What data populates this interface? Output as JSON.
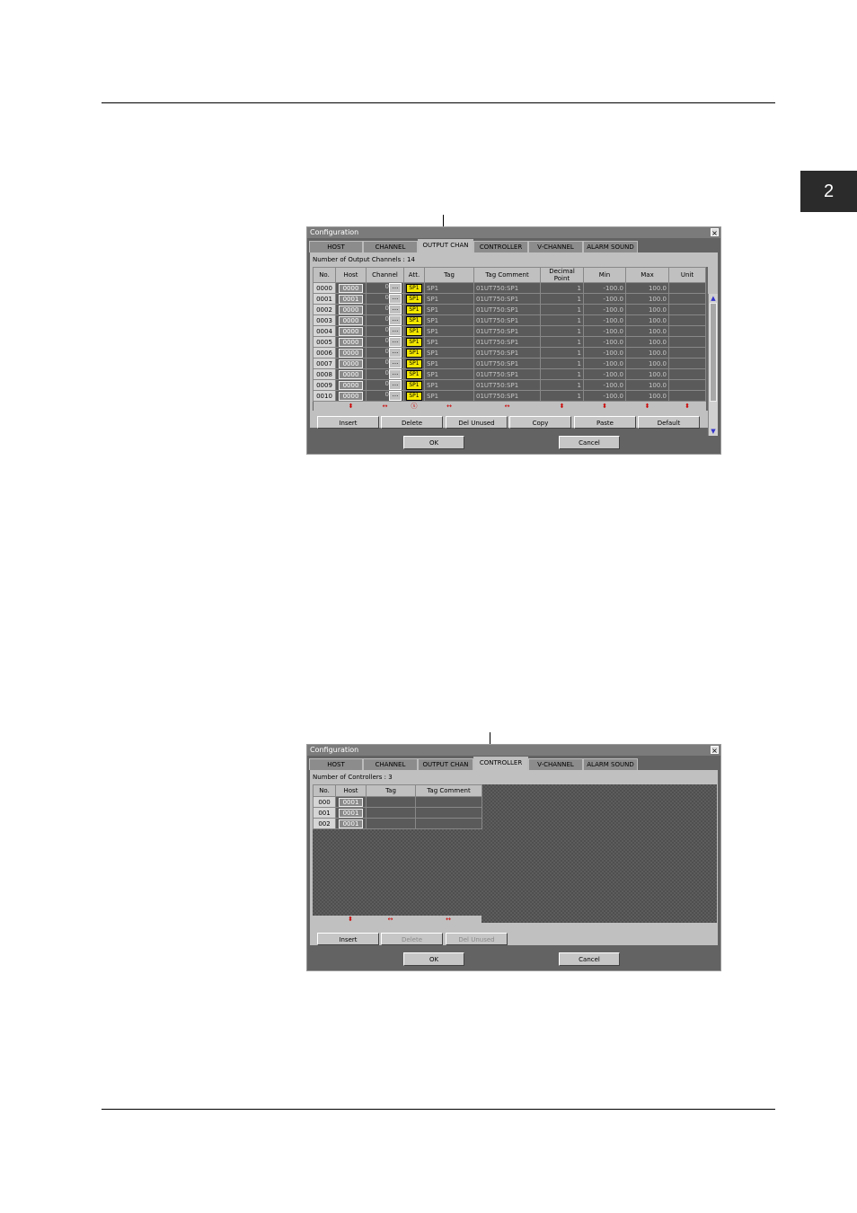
{
  "page": {
    "chapter_number": "2"
  },
  "dialog1": {
    "title": "Configuration",
    "close": "×",
    "tabs": [
      "HOST",
      "CHANNEL",
      "OUTPUT CHAN",
      "CONTROLLER",
      "V-CHANNEL",
      "ALARM SOUND"
    ],
    "active_tab": "OUTPUT CHAN",
    "count_label": "Number of Output Channels : 14",
    "columns": [
      "No.",
      "Host",
      "Channel",
      "Att.",
      "Tag",
      "Tag Comment",
      "Decimal Point",
      "Min",
      "Max",
      "Unit"
    ],
    "att_label": "SP1",
    "rows": [
      {
        "no": "0000",
        "host": "0000",
        "channel": "0",
        "tag": "SP1",
        "comment": "01UT750:SP1",
        "dp": "1",
        "min": "-100.0",
        "max": "100.0",
        "unit": ""
      },
      {
        "no": "0001",
        "host": "0001",
        "channel": "0",
        "tag": "SP1",
        "comment": "01UT750:SP1",
        "dp": "1",
        "min": "-100.0",
        "max": "100.0",
        "unit": ""
      },
      {
        "no": "0002",
        "host": "0000",
        "channel": "0",
        "tag": "SP1",
        "comment": "01UT750:SP1",
        "dp": "1",
        "min": "-100.0",
        "max": "100.0",
        "unit": ""
      },
      {
        "no": "0003",
        "host": "0000",
        "channel": "0",
        "tag": "SP1",
        "comment": "01UT750:SP1",
        "dp": "1",
        "min": "-100.0",
        "max": "100.0",
        "unit": ""
      },
      {
        "no": "0004",
        "host": "0000",
        "channel": "0",
        "tag": "SP1",
        "comment": "01UT750:SP1",
        "dp": "1",
        "min": "-100.0",
        "max": "100.0",
        "unit": ""
      },
      {
        "no": "0005",
        "host": "0000",
        "channel": "0",
        "tag": "SP1",
        "comment": "01UT750:SP1",
        "dp": "1",
        "min": "-100.0",
        "max": "100.0",
        "unit": ""
      },
      {
        "no": "0006",
        "host": "0000",
        "channel": "0",
        "tag": "SP1",
        "comment": "01UT750:SP1",
        "dp": "1",
        "min": "-100.0",
        "max": "100.0",
        "unit": ""
      },
      {
        "no": "0007",
        "host": "0000",
        "channel": "0",
        "tag": "SP1",
        "comment": "01UT750:SP1",
        "dp": "1",
        "min": "-100.0",
        "max": "100.0",
        "unit": ""
      },
      {
        "no": "0008",
        "host": "0000",
        "channel": "0",
        "tag": "SP1",
        "comment": "01UT750:SP1",
        "dp": "1",
        "min": "-100.0",
        "max": "100.0",
        "unit": ""
      },
      {
        "no": "0009",
        "host": "0000",
        "channel": "0",
        "tag": "SP1",
        "comment": "01UT750:SP1",
        "dp": "1",
        "min": "-100.0",
        "max": "100.0",
        "unit": ""
      },
      {
        "no": "0010",
        "host": "0000",
        "channel": "0",
        "tag": "SP1",
        "comment": "01UT750:SP1",
        "dp": "1",
        "min": "-100.0",
        "max": "100.0",
        "unit": ""
      }
    ],
    "sort_marks": [
      "",
      "⬍",
      "↔",
      "ⓢ",
      "↔",
      "↔",
      "⬍",
      "⬍",
      "⬍",
      "⬍"
    ],
    "buttons": [
      "Insert",
      "Delete",
      "Del Unused",
      "Copy",
      "Paste",
      "Default"
    ],
    "ok": "OK",
    "cancel": "Cancel"
  },
  "dialog2": {
    "title": "Configuration",
    "close": "×",
    "tabs": [
      "HOST",
      "CHANNEL",
      "OUTPUT CHAN",
      "CONTROLLER",
      "V-CHANNEL",
      "ALARM SOUND"
    ],
    "active_tab": "CONTROLLER",
    "count_label": "Number of Controllers : 3",
    "columns": [
      "No.",
      "Host",
      "Tag",
      "Tag Comment"
    ],
    "rows": [
      {
        "no": "000",
        "host": "0001",
        "tag": "",
        "comment": ""
      },
      {
        "no": "001",
        "host": "0001",
        "tag": "",
        "comment": ""
      },
      {
        "no": "002",
        "host": "0001",
        "tag": "",
        "comment": ""
      }
    ],
    "sort_marks": [
      "",
      "⬍",
      "↔",
      "↔"
    ],
    "buttons": [
      "Insert",
      "Delete",
      "Del Unused"
    ],
    "ok": "OK",
    "cancel": "Cancel"
  }
}
